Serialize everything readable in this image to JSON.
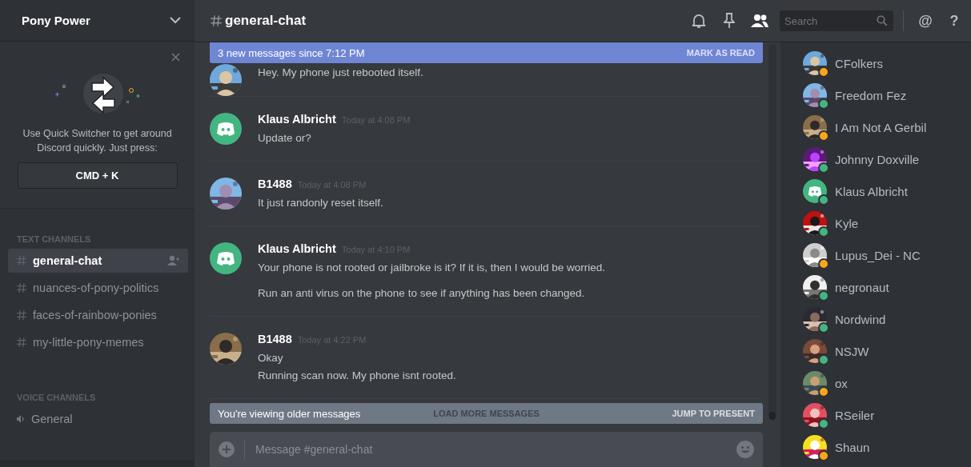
{
  "server": {
    "name": "Pony Power"
  },
  "quick_switcher": {
    "text": "Use Quick Switcher to get around Discord quickly. Just press:",
    "shortcut": "CMD + K"
  },
  "text_channels": {
    "title": "TEXT CHANNELS",
    "items": [
      {
        "name": "general-chat",
        "selected": true
      },
      {
        "name": "nuances-of-pony-politics",
        "selected": false
      },
      {
        "name": "faces-of-rainbow-ponies",
        "selected": false
      },
      {
        "name": "my-little-pony-memes",
        "selected": false
      }
    ]
  },
  "voice_channels": {
    "title": "VOICE CHANNELS",
    "items": [
      {
        "name": "General",
        "selected": false
      }
    ]
  },
  "header": {
    "channel": "general-chat",
    "search_placeholder": "Search",
    "mention_label": "@",
    "help_label": "?"
  },
  "new_messages_bar": {
    "text": "3 new messages since 7:12 PM",
    "action": "MARK AS READ"
  },
  "messages": [
    {
      "avatar": {
        "kind": "picture"
      },
      "messages": [
        {
          "lines": [
            "Hey. My phone just rebooted itself."
          ]
        }
      ]
    },
    {
      "author": "Klaus Albricht",
      "time": "Today at 4:08 PM",
      "avatar": {
        "kind": "logo"
      },
      "messages": [
        {
          "lines": [
            "Update or?"
          ]
        }
      ]
    },
    {
      "author": "B1488",
      "time": "Today at 4:08 PM",
      "avatar": {
        "kind": "picture"
      },
      "messages": [
        {
          "lines": [
            "It just randonly reset itself."
          ]
        }
      ]
    },
    {
      "author": "Klaus Albricht",
      "time": "Today at 4:10 PM",
      "avatar": {
        "kind": "logo"
      },
      "messages": [
        {
          "lines": [
            "Your phone is not rooted or jailbroke is it? If it is, then I would be worried."
          ]
        },
        {
          "lines": [
            "Run an anti virus on the phone to see if anything has been changed."
          ]
        }
      ]
    },
    {
      "author": "B1488",
      "time": "Today at 4:22 PM",
      "avatar": {
        "kind": "picture"
      },
      "messages": [
        {
          "lines": [
            "Okay",
            "Running scan now. My phone isnt rooted."
          ]
        }
      ]
    }
  ],
  "older_bar": {
    "text": "You're viewing older messages",
    "behind": "LOAD MORE MESSAGES",
    "action": "JUMP TO PRESENT"
  },
  "composer": {
    "placeholder": "Message #general-chat"
  },
  "members": [
    {
      "name": "CFolkers",
      "avatar": {
        "kind": "picture"
      },
      "color": "#faa61a"
    },
    {
      "name": "Freedom Fez",
      "avatar": {
        "kind": "picture"
      },
      "color": "#43b581"
    },
    {
      "name": "I Am Not A Gerbil",
      "avatar": {
        "kind": "picture"
      },
      "color": "#faa61a"
    },
    {
      "name": "Johnny Doxville",
      "avatar": {
        "kind": "picture"
      },
      "color": "#43b581"
    },
    {
      "name": "Klaus Albricht",
      "avatar": {
        "kind": "logo"
      },
      "color": "#43b581"
    },
    {
      "name": "Kyle",
      "avatar": {
        "kind": "picture"
      },
      "color": "#43b581"
    },
    {
      "name": "Lupus_Dei - NC",
      "avatar": {
        "kind": "picture"
      },
      "color": "#faa61a"
    },
    {
      "name": "negronaut",
      "avatar": {
        "kind": "picture"
      },
      "color": "#43b581"
    },
    {
      "name": "Nordwind",
      "avatar": {
        "kind": "picture"
      },
      "color": "#43b581"
    },
    {
      "name": "NSJW",
      "avatar": {
        "kind": "picture"
      },
      "color": "#43b581"
    },
    {
      "name": "ox",
      "avatar": {
        "kind": "picture"
      },
      "color": "#faa61a"
    },
    {
      "name": "RSeiler",
      "avatar": {
        "kind": "picture"
      },
      "color": "#43b581"
    },
    {
      "name": "Shaun",
      "avatar": {
        "kind": "picture"
      },
      "color": "#faa61a"
    }
  ]
}
